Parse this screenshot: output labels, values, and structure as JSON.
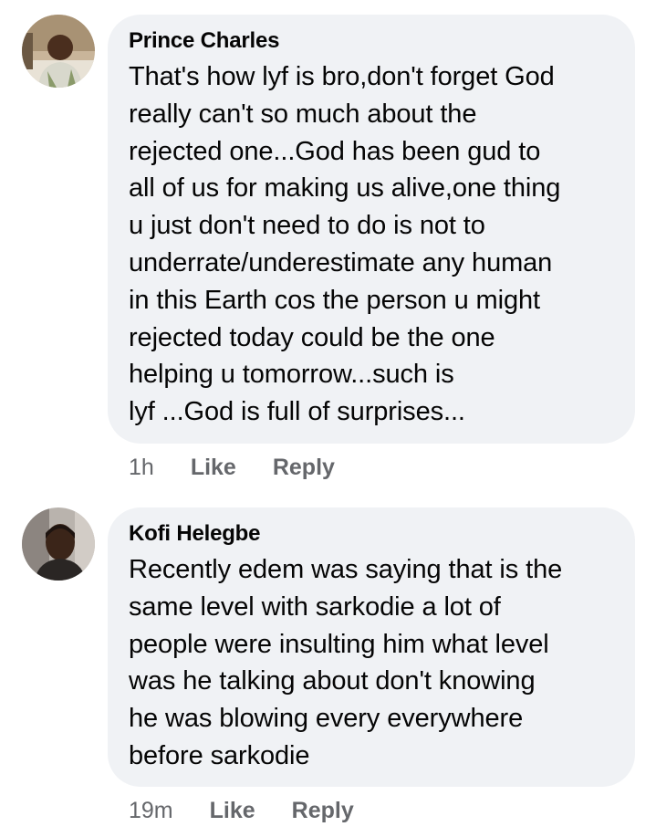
{
  "comments": [
    {
      "author": "Prince Charles",
      "avatar_icon": "user-avatar-photo",
      "text": "That's how lyf is bro,don't forget God\nreally can't so much about the\nrejected one...God has been gud to\nall of us for making us alive,one thing\nu just don't need to do is not to\nunderrate/underestimate any human\nin this Earth cos the person u might\nrejected today could be the one\nhelping u tomorrow...such is\nlyf ...God is full of surprises...",
      "time": "1h",
      "like_label": "Like",
      "reply_label": "Reply"
    },
    {
      "author": "Kofi Helegbe",
      "avatar_icon": "user-avatar-photo",
      "text": "Recently edem was saying that is the\nsame level with sarkodie a lot of\npeople were insulting him what level\nwas he talking about don't knowing\nhe was blowing every everywhere\nbefore sarkodie",
      "time": "19m",
      "like_label": "Like",
      "reply_label": "Reply"
    }
  ],
  "colors": {
    "bubble": "#f0f2f5",
    "text": "#050505",
    "secondary": "#65676b"
  }
}
